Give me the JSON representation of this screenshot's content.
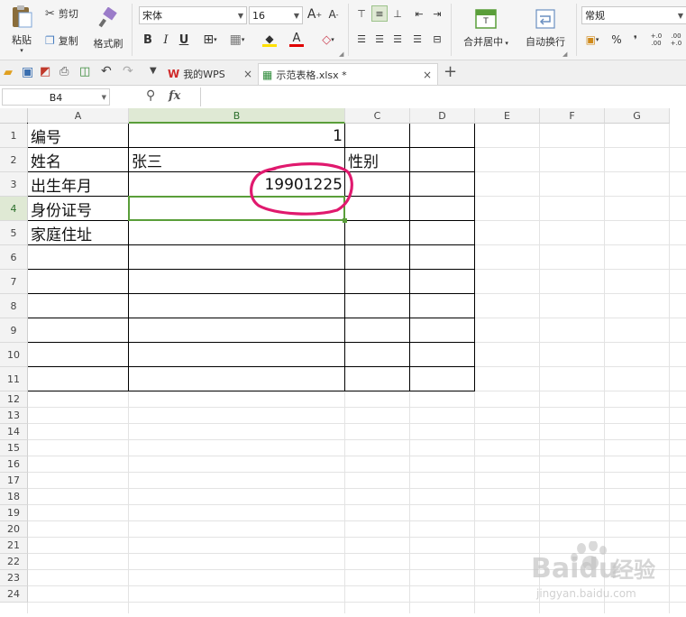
{
  "ribbon": {
    "paste_label": "粘贴",
    "cut_label": "剪切",
    "copy_label": "复制",
    "format_painter_label": "格式刷",
    "font_name": "宋体",
    "font_size": "16",
    "bold_label": "B",
    "italic_label": "I",
    "underline_label": "U",
    "increase_font_label": "A",
    "decrease_font_label": "A",
    "font_color_label": "A",
    "merge_center_label": "合并居中",
    "wrap_text_label": "自动换行",
    "number_format": "常规",
    "percent_label": "%",
    "comma_label": "❜",
    "inc_decimal_label": "+.0 .00",
    "dec_decimal_label": ".00 +.0"
  },
  "tabs": {
    "home_tab_label": "我的WPS",
    "doc_tab_label": "示范表格.xlsx *",
    "close_label": "×",
    "new_label": "+"
  },
  "formula_bar": {
    "name_box": "B4",
    "fx_label": "fx",
    "formula_value": ""
  },
  "sheet": {
    "columns": [
      "A",
      "B",
      "C",
      "D",
      "E",
      "F",
      "G"
    ],
    "selected_column": "B",
    "rows": [
      "1",
      "2",
      "3",
      "4",
      "5",
      "6",
      "7",
      "8",
      "9",
      "10",
      "11",
      "12",
      "13",
      "14",
      "15",
      "16",
      "17",
      "18",
      "19",
      "20",
      "21",
      "22",
      "23",
      "24"
    ],
    "selected_row": "4",
    "selected_cell": "B4",
    "cells": {
      "A1": "编号",
      "B1": "1",
      "A2": "姓名",
      "B2": "张三",
      "C2": "性别",
      "A3": "出生年月",
      "B3": "19901225",
      "A4": "身份证号",
      "A5": "家庭住址"
    }
  },
  "annotation": {
    "color": "#e0196e",
    "shape": "hand-drawn-ellipse"
  },
  "colors": {
    "accent_green": "#5a9e3a",
    "header_bg": "#f3f3f3",
    "highlight": "#e0196e"
  },
  "watermark": {
    "brand": "Baidu",
    "brand_cn": "经验",
    "url": "jingyan.baidu.com"
  }
}
